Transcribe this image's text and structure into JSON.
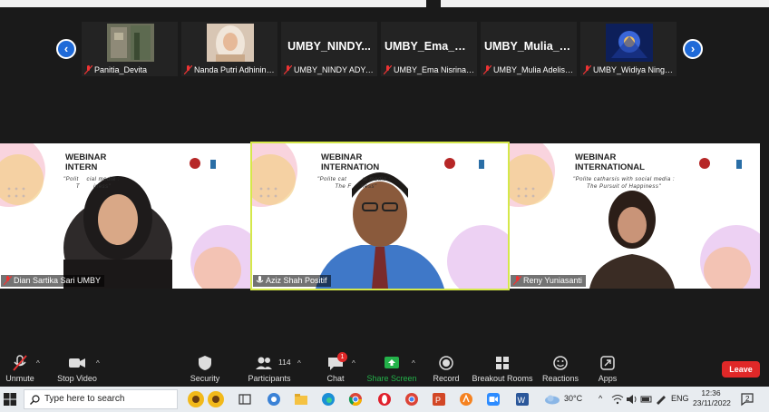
{
  "gallery": {
    "tiles": [
      {
        "display_name": "",
        "label": "Panitia_Devita"
      },
      {
        "display_name": "",
        "label": "Nanda Putri Adhiningt..."
      },
      {
        "display_name": "UMBY_NINDY...",
        "label": "UMBY_NINDY ADYA RI..."
      },
      {
        "display_name": "UMBY_Ema_Nisr...",
        "label": "UMBY_Ema Nisrina M"
      },
      {
        "display_name": "UMBY_Mulia_A...",
        "label": "UMBY_Mulia Adelisa P..."
      },
      {
        "display_name": "",
        "label": "UMBY_Widiya Ningrum"
      }
    ],
    "prev_arrow": "‹",
    "next_arrow": "›"
  },
  "speakers": [
    {
      "name": "Dian Sartika Sari UMBY",
      "webinar_title": "WEBINAR\nINTERN",
      "subtitle": "\"Polit    cial media :\n  T       iness\"",
      "active": false
    },
    {
      "name": "Aziz Shah Positif",
      "webinar_title": "WEBINAR\nINTERNATION",
      "subtitle": "\"Polite cat        al media :\n  The F     ness\"",
      "active": true
    },
    {
      "name": "Reny Yuniasanti",
      "webinar_title": "WEBINAR\nINTERNATIONAL",
      "subtitle": "\"Polite catharsis with social media :\nThe Pursuit of Happiness\"",
      "active": false
    }
  ],
  "toolbar": {
    "unmute": "Unmute",
    "stop_video": "Stop Video",
    "security": "Security",
    "participants": "Participants",
    "participants_count": "114",
    "chat": "Chat",
    "chat_badge": "1",
    "share_screen": "Share Screen",
    "record": "Record",
    "breakout_rooms": "Breakout Rooms",
    "reactions": "Reactions",
    "apps": "Apps",
    "leave": "Leave"
  },
  "taskbar": {
    "search_placeholder": "Type here to search",
    "temperature": "30°C",
    "language": "ENG",
    "time": "12:36",
    "date": "23/11/2022",
    "notification_count": "2"
  },
  "colors": {
    "accent_blue": "#1f6ad8",
    "leave_red": "#e02828",
    "active_border": "#d5e84a",
    "share_green": "#24b24a"
  }
}
